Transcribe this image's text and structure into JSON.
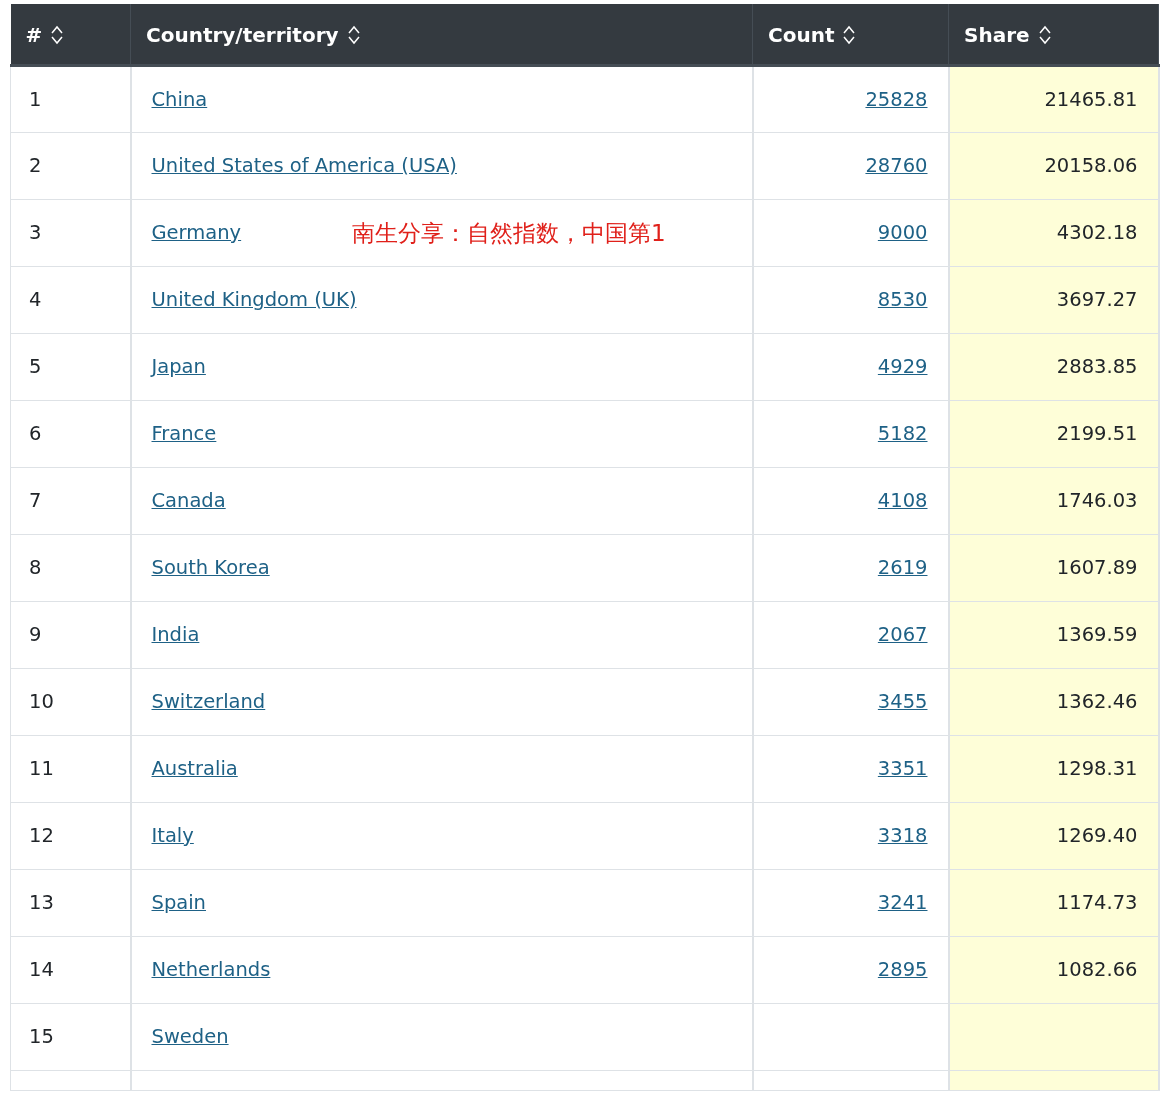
{
  "table": {
    "columns": [
      {
        "label": "#",
        "highlighted": false
      },
      {
        "label": "Country/territory",
        "highlighted": false
      },
      {
        "label": "Count",
        "highlighted": false
      },
      {
        "label": "Share",
        "highlighted": true
      }
    ],
    "rows": [
      {
        "rank": "1",
        "country": "China",
        "count": "25828",
        "share": "21465.81"
      },
      {
        "rank": "2",
        "country": "United States of America (USA)",
        "count": "28760",
        "share": "20158.06"
      },
      {
        "rank": "3",
        "country": "Germany",
        "count": "9000",
        "share": "4302.18"
      },
      {
        "rank": "4",
        "country": "United Kingdom (UK)",
        "count": "8530",
        "share": "3697.27"
      },
      {
        "rank": "5",
        "country": "Japan",
        "count": "4929",
        "share": "2883.85"
      },
      {
        "rank": "6",
        "country": "France",
        "count": "5182",
        "share": "2199.51"
      },
      {
        "rank": "7",
        "country": "Canada",
        "count": "4108",
        "share": "1746.03"
      },
      {
        "rank": "8",
        "country": "South Korea",
        "count": "2619",
        "share": "1607.89"
      },
      {
        "rank": "9",
        "country": "India",
        "count": "2067",
        "share": "1369.59"
      },
      {
        "rank": "10",
        "country": "Switzerland",
        "count": "3455",
        "share": "1362.46"
      },
      {
        "rank": "11",
        "country": "Australia",
        "count": "3351",
        "share": "1298.31"
      },
      {
        "rank": "12",
        "country": "Italy",
        "count": "3318",
        "share": "1269.40"
      },
      {
        "rank": "13",
        "country": "Spain",
        "count": "3241",
        "share": "1174.73"
      },
      {
        "rank": "14",
        "country": "Netherlands",
        "count": "2895",
        "share": "1082.66"
      },
      {
        "rank": "15",
        "country": "Sweden"
      }
    ]
  },
  "overlay_note": "南生分享：自然指数，中国第1"
}
